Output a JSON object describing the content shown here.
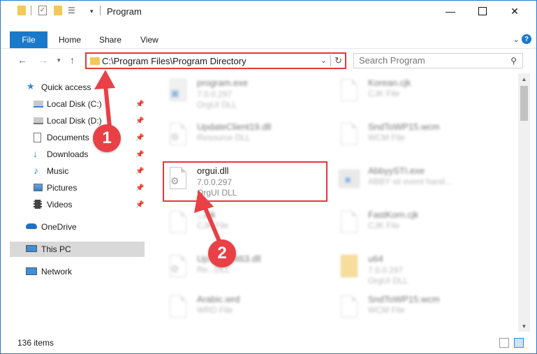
{
  "window": {
    "title": "Program",
    "minimize_icon": "minimize-icon",
    "maximize_icon": "maximize-icon",
    "close_icon": "close-icon"
  },
  "ribbon": {
    "tabs": [
      "File",
      "Home",
      "Share",
      "View"
    ],
    "help_label": "?"
  },
  "nav": {
    "address": "C:\\Program Files\\Program Directory",
    "search_placeholder": "Search Program"
  },
  "sidebar": {
    "items": [
      {
        "label": "Quick access",
        "icon": "star-icon"
      },
      {
        "label": "Local Disk (C:)",
        "icon": "drive-icon",
        "pinned": true
      },
      {
        "label": "Local Disk (D:)",
        "icon": "drive-icon",
        "pinned": true
      },
      {
        "label": "Documents",
        "icon": "documents-icon",
        "pinned": true
      },
      {
        "label": "Downloads",
        "icon": "download-icon",
        "pinned": true
      },
      {
        "label": "Music",
        "icon": "music-icon",
        "pinned": true
      },
      {
        "label": "Pictures",
        "icon": "pictures-icon",
        "pinned": true
      },
      {
        "label": "Videos",
        "icon": "videos-icon",
        "pinned": true
      },
      {
        "label": "OneDrive",
        "icon": "cloud-icon"
      },
      {
        "label": "This PC",
        "icon": "computer-icon",
        "selected": true
      },
      {
        "label": "Network",
        "icon": "network-icon"
      }
    ]
  },
  "files": [
    {
      "name": "program.exe",
      "version": "7.0.0.297",
      "desc": "OrgUI DLL"
    },
    {
      "name": "Korean.cjk",
      "version": "",
      "desc": "CJK File"
    },
    {
      "name": "UpdateClient19.dll",
      "version": "",
      "desc": "Resource DLL"
    },
    {
      "name": "SndToWP15.wcm",
      "version": "",
      "desc": "WCM File"
    },
    {
      "name": "orgui.dll",
      "version": "7.0.0.297",
      "desc": "OrgUI DLL"
    },
    {
      "name": "AbbyySTI.exe",
      "version": "",
      "desc": "ABBY sti event hand..."
    },
    {
      "name": "...cjk",
      "version": "",
      "desc": "CJK File"
    },
    {
      "name": "FastKorn.cjk",
      "version": "",
      "desc": "CJK File"
    },
    {
      "name": "Up...Client63.dll",
      "version": "",
      "desc": "Re...DLL"
    },
    {
      "name": "u64",
      "version": "7.0.0.297",
      "desc": "OrgUI DLL"
    },
    {
      "name": "Arabic.wrd",
      "version": "",
      "desc": "WRD File"
    },
    {
      "name": "SndToWP15.wcm",
      "version": "",
      "desc": "WCM File"
    }
  ],
  "status": {
    "item_count": "136 items"
  },
  "markers": [
    "1",
    "2"
  ],
  "colors": {
    "accent": "#1979ca",
    "highlight_red": "#e0393a",
    "marker_red": "#e94046",
    "folder_yellow": "#f2c85a"
  }
}
